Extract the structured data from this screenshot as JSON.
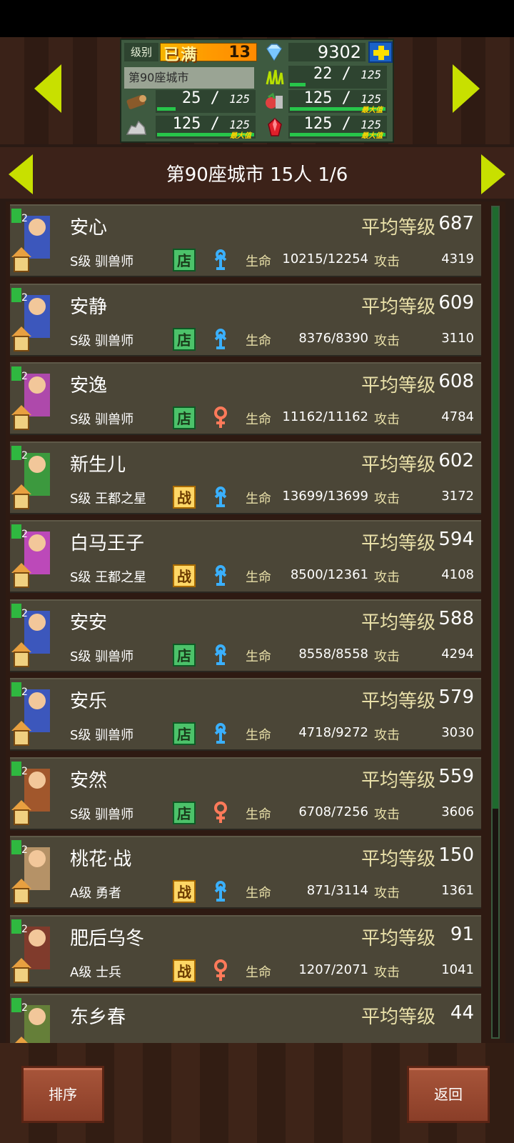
{
  "header": {
    "level_label": "级别",
    "level_max_label": "已满",
    "level_value": "13",
    "gems": "9302",
    "city_name": "第90座城市",
    "resources": [
      {
        "id": "wood",
        "current": "25",
        "cap": "125",
        "fill": 0.2,
        "max_label": ""
      },
      {
        "id": "grass",
        "current": "22",
        "cap": "125",
        "fill": 0.176,
        "max_label": ""
      },
      {
        "id": "food",
        "current": "125",
        "cap": "125",
        "fill": 1.0,
        "max_label": "最大值"
      },
      {
        "id": "stone",
        "current": "125",
        "cap": "125",
        "fill": 1.0,
        "max_label": "最大值"
      },
      {
        "id": "ruby",
        "current": "125",
        "cap": "125",
        "fill": 1.0,
        "max_label": "最大值"
      }
    ]
  },
  "title": {
    "text": "第90座城市  15人 1/6"
  },
  "units": [
    {
      "name": "安心",
      "level_label": "平均等级",
      "level": "687",
      "class": "S级 驯兽师",
      "role": "店",
      "role_type": "shop",
      "gender": "male",
      "hp_label": "生命",
      "hp": "10215/12254",
      "atk_label": "攻击",
      "atk": "4319",
      "color": "#3a5bd4"
    },
    {
      "name": "安静",
      "level_label": "平均等级",
      "level": "609",
      "class": "S级 驯兽师",
      "role": "店",
      "role_type": "shop",
      "gender": "male",
      "hp_label": "生命",
      "hp": "8376/8390",
      "atk_label": "攻击",
      "atk": "3110",
      "color": "#3a5bd4"
    },
    {
      "name": "安逸",
      "level_label": "平均等级",
      "level": "608",
      "class": "S级 驯兽师",
      "role": "店",
      "role_type": "shop",
      "gender": "female",
      "hp_label": "生命",
      "hp": "11162/11162",
      "atk_label": "攻击",
      "atk": "4784",
      "color": "#c04ac0"
    },
    {
      "name": "新生儿",
      "level_label": "平均等级",
      "level": "602",
      "class": "S级 王都之星",
      "role": "战",
      "role_type": "war",
      "gender": "male",
      "hp_label": "生命",
      "hp": "13699/13699",
      "atk_label": "攻击",
      "atk": "3172",
      "color": "#3aa840"
    },
    {
      "name": "白马王子",
      "level_label": "平均等级",
      "level": "594",
      "class": "S级 王都之星",
      "role": "战",
      "role_type": "war",
      "gender": "male",
      "hp_label": "生命",
      "hp": "8500/12361",
      "atk_label": "攻击",
      "atk": "4108",
      "color": "#d04ad0"
    },
    {
      "name": "安安",
      "level_label": "平均等级",
      "level": "588",
      "class": "S级 驯兽师",
      "role": "店",
      "role_type": "shop",
      "gender": "male",
      "hp_label": "生命",
      "hp": "8558/8558",
      "atk_label": "攻击",
      "atk": "4294",
      "color": "#3a5bd4"
    },
    {
      "name": "安乐",
      "level_label": "平均等级",
      "level": "579",
      "class": "S级 驯兽师",
      "role": "店",
      "role_type": "shop",
      "gender": "male",
      "hp_label": "生命",
      "hp": "4718/9272",
      "atk_label": "攻击",
      "atk": "3030",
      "color": "#3a5bd4"
    },
    {
      "name": "安然",
      "level_label": "平均等级",
      "level": "559",
      "class": "S级 驯兽师",
      "role": "店",
      "role_type": "shop",
      "gender": "female",
      "hp_label": "生命",
      "hp": "6708/7256",
      "atk_label": "攻击",
      "atk": "3606",
      "color": "#b05a2a"
    },
    {
      "name": "桃花·战",
      "level_label": "平均等级",
      "level": "150",
      "class": "A级 勇者",
      "role": "战",
      "role_type": "war",
      "gender": "male",
      "hp_label": "生命",
      "hp": "871/3114",
      "atk_label": "攻击",
      "atk": "1361",
      "color": "#c8a070"
    },
    {
      "name": "肥后乌冬",
      "level_label": "平均等级",
      "level": "91",
      "class": "A级 士兵",
      "role": "战",
      "role_type": "war",
      "gender": "female",
      "hp_label": "生命",
      "hp": "1207/2071",
      "atk_label": "攻击",
      "atk": "1041",
      "color": "#8a3a2a"
    },
    {
      "name": "东乡春",
      "level_label": "平均等级",
      "level": "44",
      "class": "",
      "role": "",
      "role_type": "",
      "gender": "",
      "hp_label": "",
      "hp": "",
      "atk_label": "",
      "atk": "",
      "color": "#6a8a3a"
    }
  ],
  "buttons": {
    "sort": "排序",
    "back": "返回"
  },
  "colors": {
    "accent_arrow": "#c8e000",
    "shop": "#4cc26a",
    "war": "#ffd766",
    "male": "#3ab0ff",
    "female": "#ff7a5a"
  }
}
